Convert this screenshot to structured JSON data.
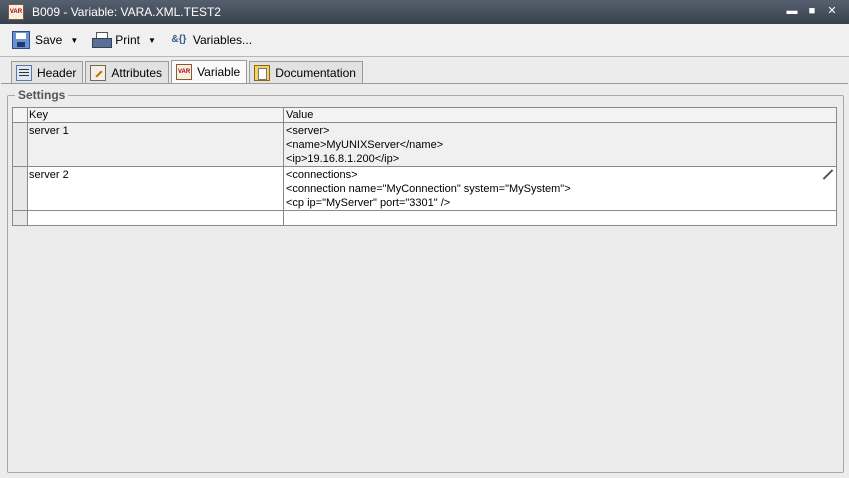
{
  "window": {
    "title": "B009 - Variable: VARA.XML.TEST2",
    "app_icon_text": "VAR",
    "minimize": "▬",
    "maximize": "■",
    "close": "✕"
  },
  "toolbar": {
    "save_label": "Save",
    "print_label": "Print",
    "variables_label": "Variables...",
    "dropdown_arrow": "▼",
    "variables_icon_text": "&{}"
  },
  "tabs": [
    {
      "label": "Header",
      "icon": "header-icon",
      "active": false
    },
    {
      "label": "Attributes",
      "icon": "attributes-icon",
      "active": false
    },
    {
      "label": "Variable",
      "icon": "variable-icon",
      "active": true
    },
    {
      "label": "Documentation",
      "icon": "documentation-icon",
      "active": false
    }
  ],
  "tab_var_icon_text": "VAR",
  "settings": {
    "group_title": "Settings",
    "columns": {
      "key": "Key",
      "value": "Value"
    },
    "rows": [
      {
        "key": "server 1",
        "value_lines": [
          "<server>",
          "<name>MyUNIXServer</name>",
          "<ip>19.16.8.1.200</ip>"
        ]
      },
      {
        "key": "server 2",
        "value_lines": [
          "<connections>",
          "<connection name=\"MyConnection\" system=\"MySystem\">",
          "<cp ip=\"MyServer\" port=\"3301\" />"
        ]
      },
      {
        "key": "",
        "value_lines": []
      }
    ]
  }
}
